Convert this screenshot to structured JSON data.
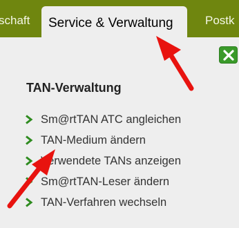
{
  "tabs": {
    "left_label": "schaft",
    "active_label": "Service & Verwaltung",
    "right_label": "Postk"
  },
  "close_icon": "close-x-icon",
  "section": {
    "title": "TAN-Verwaltung",
    "items": [
      {
        "label": "Sm@rtTAN ATC angleichen"
      },
      {
        "label": "TAN-Medium ändern"
      },
      {
        "label": "Verwendete TANs anzeigen"
      },
      {
        "label": "Sm@rtTAN-Leser ändern"
      },
      {
        "label": "TAN-Verfahren wechseln"
      }
    ]
  },
  "colors": {
    "tabbar": "#6f860f",
    "chevron": "#2e8b1f",
    "arrow": "#e8130f"
  }
}
